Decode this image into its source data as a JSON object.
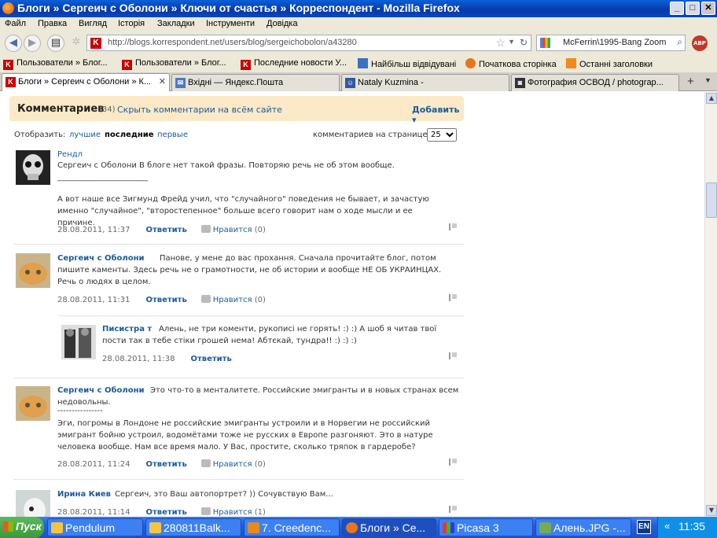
{
  "window": {
    "title": "Блоги » Сергеич с Оболони » Ключи от счастья » Корреспондент - Mozilla Firefox",
    "min": "_",
    "max": "□",
    "close": "✕"
  },
  "menu": [
    "Файл",
    "Правка",
    "Вигляд",
    "Історія",
    "Закладки",
    "Інструменти",
    "Довідка"
  ],
  "nav": {
    "url": "http://blogs.korrespondent.net/users/blog/sergeichobolon/a43280",
    "search": "McFerrin\\1995-Bang Zoom",
    "abp": "ABP"
  },
  "bookmarks": [
    "Пользователи » Блог...",
    "Пользователи » Блог...",
    "Последние новости У...",
    "Найбільш відвідувані",
    "Початкова сторінка",
    "Останні заголовки"
  ],
  "tabs": [
    "Блоги » Сергеич с Оболони » К...",
    "Вхідні — Яндекс.Пошта",
    "Nataly Kuzmina -",
    "Фотография ОСВОД / photograp..."
  ],
  "comments_header": {
    "title": "Комментариев",
    "count": "(34)",
    "hide": "Скрыть комментарии на всём сайте",
    "add": "Добавить ▾"
  },
  "filter": {
    "show": "Отобразить:",
    "best": "лучшие",
    "latest": "последние",
    "first": "первые",
    "per_page": "комментариев на странице",
    "per_page_value": "25"
  },
  "comments": [
    {
      "name": "Рендл",
      "text1": "Сергеич с Оболони В блоге нет такой фразы. Повторяю речь не об этом вообще.",
      "divider": "_______________________",
      "text2": "А вот наше все Зигмунд Фрейд учил, что \"случайного\" поведения не бывает, и зачастую именно \"случайное\", \"второстепенное\" больше всего говорит нам о ходе мысли и ее причине.",
      "date": "28.08.2011, 11:37",
      "reply": "Ответить",
      "like": "Нравится",
      "likes": "(0)"
    },
    {
      "name": "Сергеич с Оболони",
      "text1": "Панове, у мене до вас прохання. Сначала прочитайте блог, потом пишите каменты. Здесь речь не о грамотности, не об истории и вообще НЕ ОБ УКРАИНЦАХ. Речь о людях в целом.",
      "date": "28.08.2011, 11:31",
      "reply": "Ответить",
      "like": "Нравится",
      "likes": "(0)"
    },
    {
      "name": "Писистра т",
      "text1": "Алень, не три коменти, рукописі не горять! :) :) А шоб я читав твої пости так в тебе стіки грошей нема! Абтєкай, тундра!! :) :) :)",
      "date": "28.08.2011, 11:38",
      "reply": "Ответить"
    },
    {
      "name": "Сергеич с Оболони",
      "text1": "Это что-то в менталитете. Российские эмигранты и в новых странах всем недовольны.",
      "divider": "----------------",
      "text2": "Эги, погромы в Лондоне не российские эмигранты устроили и в Норвегии не российский эмигрант бойню устроил, водомётами тоже не русских в Европе разгоняют. Это в натуре человека вообще. Нам все время мало. У Вас, простите, сколько тряпок в гардеробе?",
      "date": "28.08.2011, 11:24",
      "reply": "Ответить",
      "like": "Нравится",
      "likes": "(0)"
    },
    {
      "name": "Ирина Киев",
      "text1": "Сергеич, это Ваш автопортрет? )) Сочувствую Вам...",
      "date": "28.08.2011, 11:14",
      "reply": "Ответить",
      "like": "Нравится",
      "likes": "(1)"
    }
  ],
  "taskbar": {
    "start": "Пуск",
    "items": [
      "Pendulum",
      "280811Balk...",
      "7. Creedenc...",
      "Блоги » Се...",
      "Picasa 3",
      "Алень.JPG -..."
    ],
    "lang": "EN",
    "chevron": "«",
    "clock": "11:35"
  }
}
